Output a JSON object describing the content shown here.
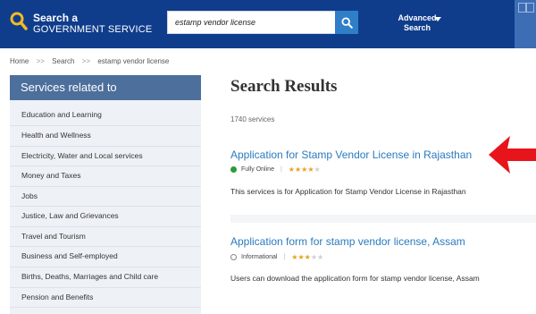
{
  "header": {
    "brand_line1": "Search a",
    "brand_line2": "GOVERNMENT SERVICE",
    "search_value": "estamp vendor license",
    "advanced_line1": "Advanced",
    "advanced_line2": "Search",
    "icons": {
      "logo": "magnifier-icon",
      "search": "search-icon",
      "caret": "chevron-down-icon"
    },
    "colors": {
      "bar": "#0f3d8c",
      "search_button": "#2f7ec8",
      "logo": "#f2b824"
    }
  },
  "breadcrumb": {
    "items": [
      "Home",
      "Search",
      "estamp vendor license"
    ],
    "separator": ">>"
  },
  "sidebar": {
    "title": "Services related to",
    "items": [
      "Education and Learning",
      "Health and Wellness",
      "Electricity, Water and Local services",
      "Money and Taxes",
      "Jobs",
      "Justice, Law and Grievances",
      "Travel and Tourism",
      "Business and Self-employed",
      "Births, Deaths, Marriages and Child care",
      "Pension and Benefits"
    ]
  },
  "main": {
    "title": "Search Results",
    "count": "1740 services",
    "results": [
      {
        "title": "Application for Stamp Vendor License in Rajasthan",
        "status": "Fully Online",
        "rating": 4,
        "rating_max": 5,
        "description": "This services is for Application for Stamp Vendor License in Rajasthan"
      },
      {
        "title": "Application form for stamp vendor license, Assam",
        "status": "Informational",
        "rating": 3,
        "rating_max": 5,
        "description": "Users can download the application form for stamp vendor license, Assam"
      }
    ]
  },
  "annotation": {
    "arrow_color": "#e8141c",
    "icon": "red-arrow-icon"
  }
}
